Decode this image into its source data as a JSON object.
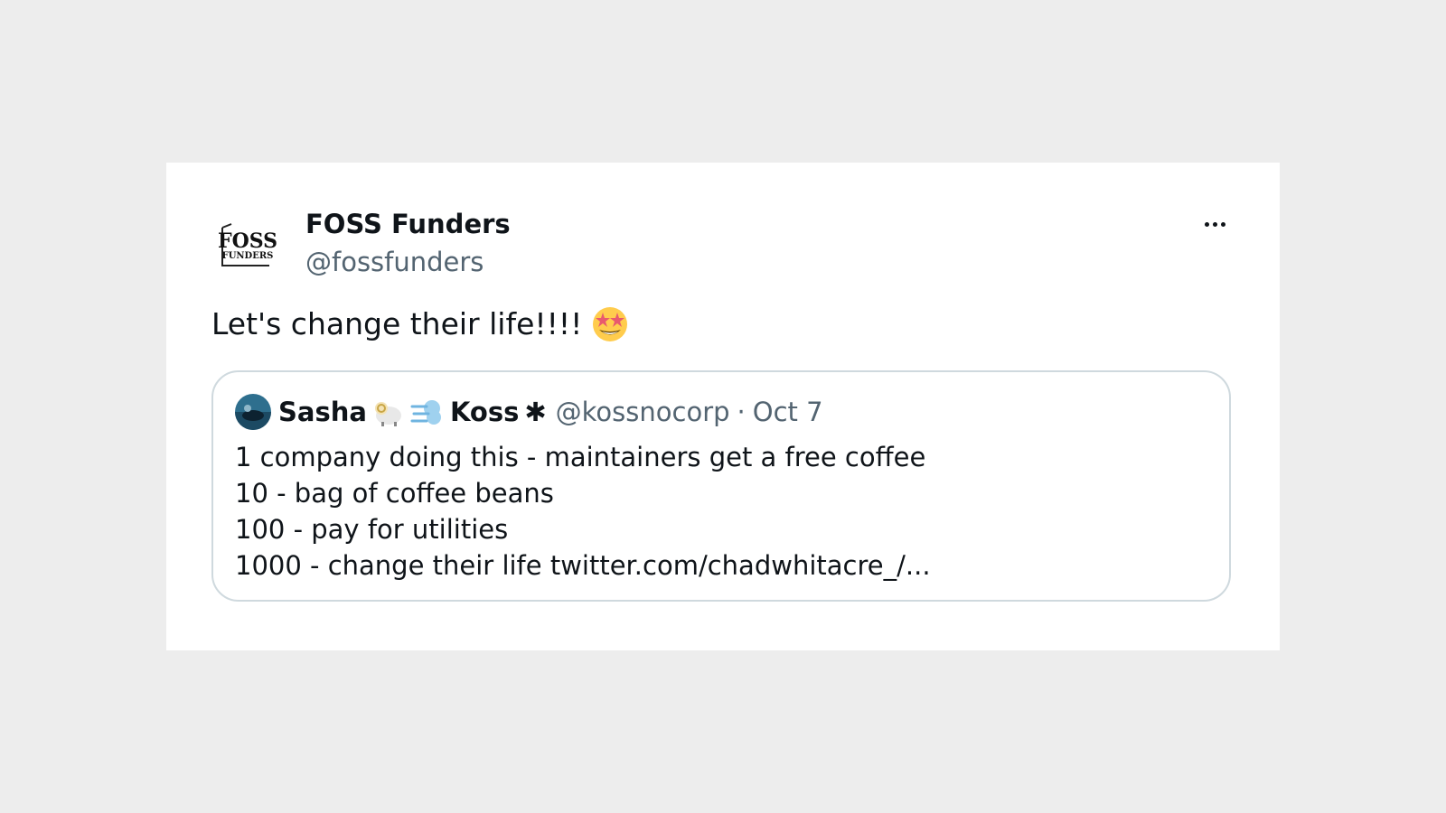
{
  "colors": {
    "page_background": "#ededed",
    "card_background": "#ffffff",
    "text_primary": "#0f1419",
    "text_secondary": "#536471",
    "quote_border": "#cfd9de"
  },
  "tweet": {
    "avatar_logo_line1": "FOSS",
    "avatar_logo_line2": "FUNDERS",
    "display_name": "FOSS Funders",
    "handle": "@fossfunders",
    "more_icon": "more-horizontal-icon",
    "text": "Let's change their life!!!!",
    "text_emoji": "star-struck-emoji-icon"
  },
  "quoted_tweet": {
    "author_first": "Sasha",
    "author_emojis": [
      "ram-emoji-icon",
      "dash-emoji-icon"
    ],
    "author_last": "Koss",
    "author_symbol": "✱",
    "handle": "@kossnocorp",
    "separator": "·",
    "date": "Oct 7",
    "lines": [
      "1 company doing this - maintainers get a free coffee",
      "10 - bag of coffee beans",
      "100 - pay for utilities",
      "1000 - change their life twitter.com/chadwhitacre_/..."
    ]
  }
}
